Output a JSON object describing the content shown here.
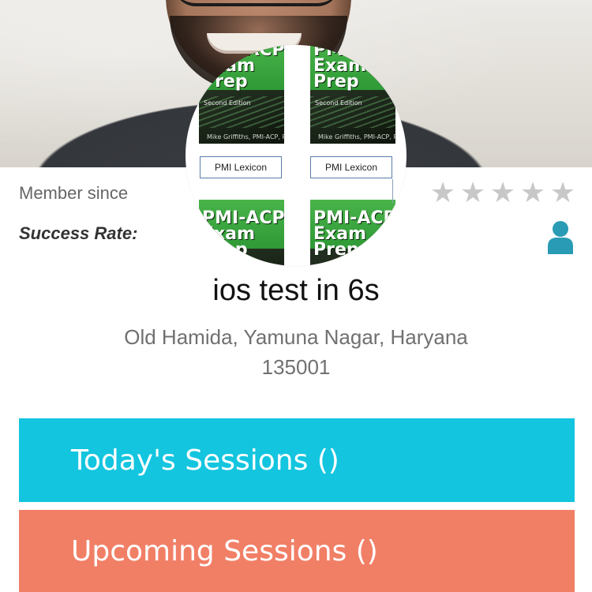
{
  "books": [
    {
      "title": "PMI-ACP\nExam\nPrep",
      "edition": "Second Edition",
      "author": "Mike Griffiths, PMI-ACP, PMP"
    },
    {
      "title": "PMI-ACP\nExam\nPrep",
      "edition": "Second Edition",
      "author": "Mike Griffiths, PMI-ACP, PMP"
    }
  ],
  "lexicon_labels": [
    "PMI Lexicon",
    "PMI Lexicon"
  ],
  "profile": {
    "member_since_label": "Member since",
    "success_rate_label": "Success Rate:",
    "rating_stars": 5,
    "rating_filled": 0,
    "name": "ios test in 6s",
    "address_line1": "Old Hamida, Yamuna Nagar, Haryana",
    "address_line2": "135001"
  },
  "buttons": {
    "today_sessions": "Today's Sessions ()",
    "upcoming_sessions": "Upcoming Sessions ()"
  },
  "icons": {
    "star": "star-icon",
    "user": "user-icon"
  },
  "colors": {
    "today_button": "#13c5df",
    "upcoming_button": "#f17f66",
    "user_icon": "#2a9bb5",
    "star_empty": "#c8c8c8"
  }
}
